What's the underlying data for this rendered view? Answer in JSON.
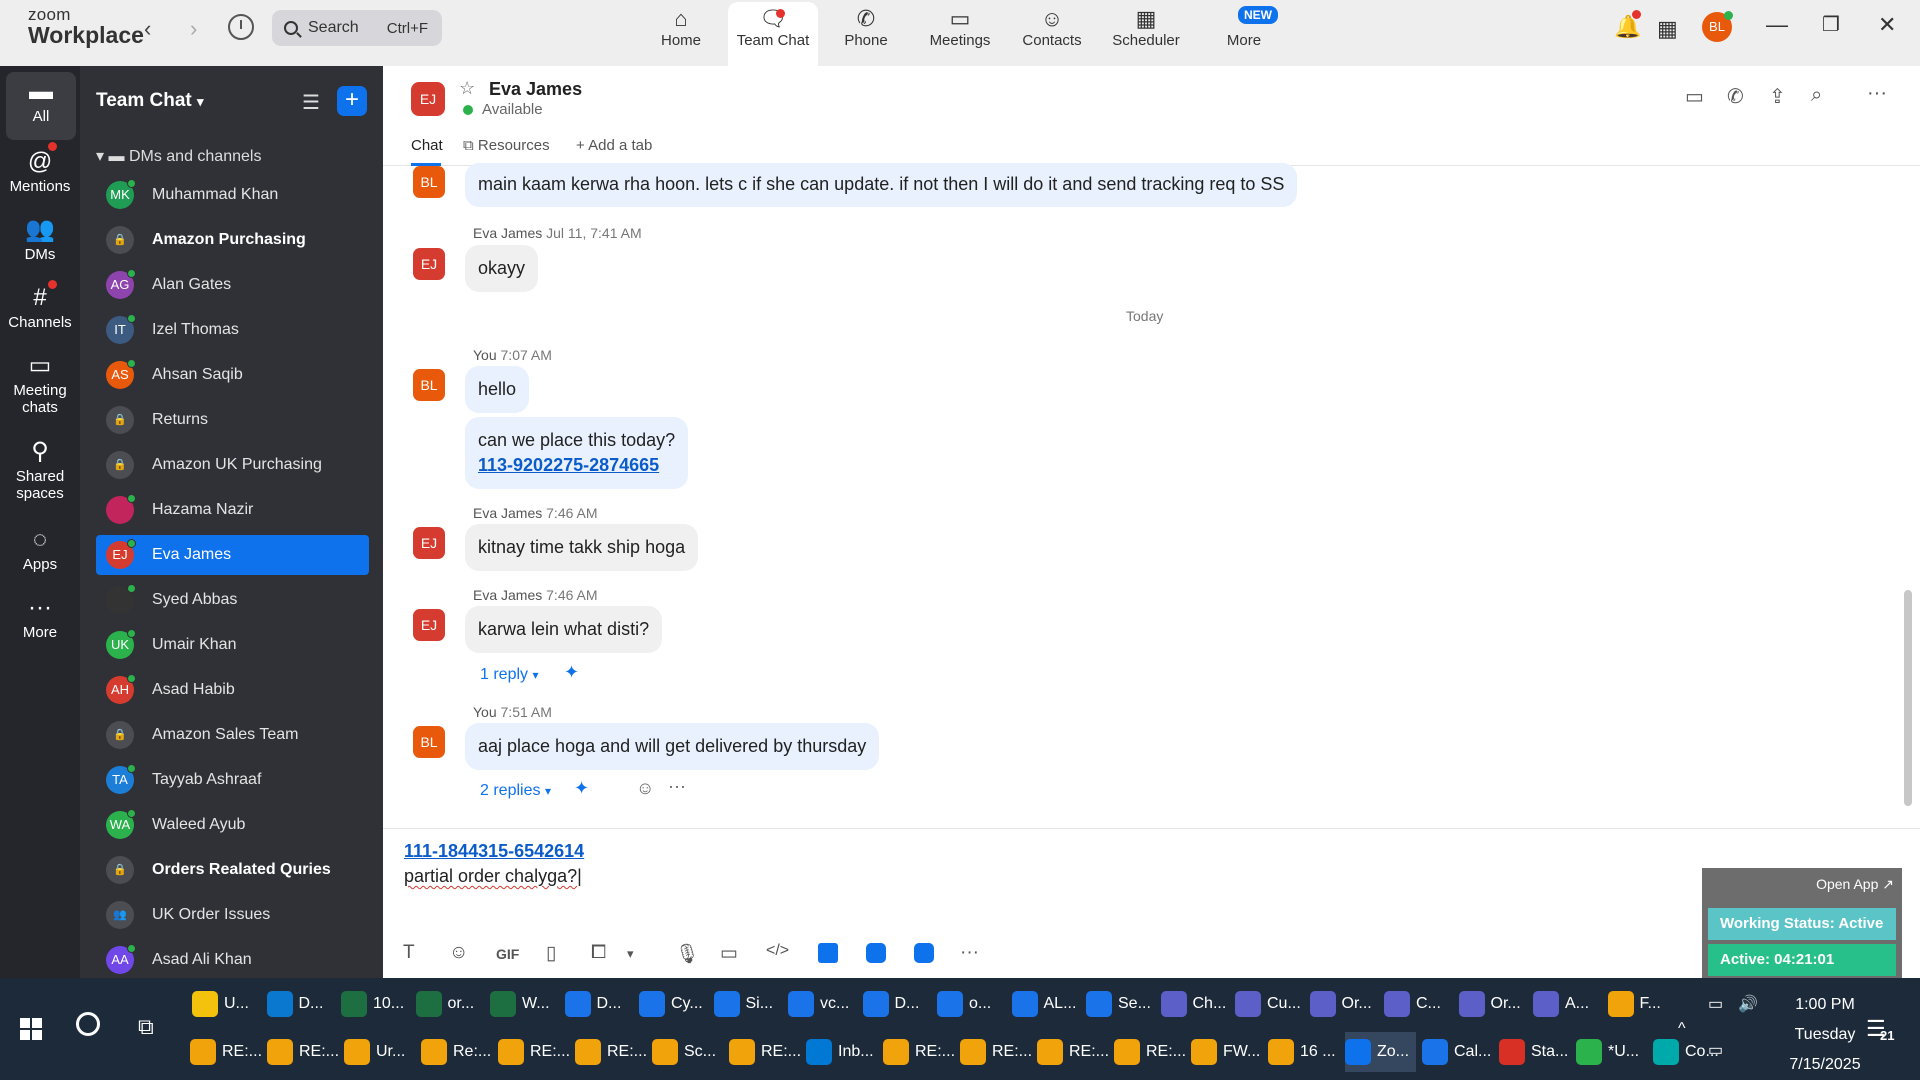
{
  "app": {
    "logo_line1": "zoom",
    "logo_line2": "Workplace"
  },
  "topbar": {
    "search_label": "Search",
    "search_shortcut": "Ctrl+F",
    "nav": [
      {
        "label": "Home",
        "icon": "home-icon"
      },
      {
        "label": "Team Chat",
        "icon": "team-chat-icon"
      },
      {
        "label": "Phone",
        "icon": "phone-icon"
      },
      {
        "label": "Meetings",
        "icon": "video-camera-icon"
      },
      {
        "label": "Contacts",
        "icon": "contacts-icon"
      },
      {
        "label": "Scheduler",
        "icon": "calendar-icon"
      },
      {
        "label": "More",
        "icon": "more-icon"
      }
    ],
    "new_badge": "NEW",
    "user_initials": "BL"
  },
  "rail": [
    {
      "label": "All",
      "icon": "chat-bubble-icon"
    },
    {
      "label": "Mentions",
      "icon": "at-icon"
    },
    {
      "label": "DMs",
      "icon": "people-icon"
    },
    {
      "label": "Channels",
      "icon": "hash-icon"
    },
    {
      "label": "Meeting\nchats",
      "label1": "Meeting",
      "label2": "chats",
      "icon": "calendar-icon"
    },
    {
      "label1": "Shared",
      "label2": "spaces",
      "icon": "shared-spaces-icon"
    },
    {
      "label": "Apps",
      "icon": "apps-icon"
    },
    {
      "label": "More",
      "icon": "ellipsis-icon"
    }
  ],
  "sidebar": {
    "title": "Team Chat",
    "section": "DMs and channels",
    "items": [
      {
        "name": "Muhammad Khan",
        "initials": "MK",
        "color": "#1f9d55"
      },
      {
        "name": "Amazon Purchasing",
        "initials": "",
        "lock": true,
        "bold": true
      },
      {
        "name": "Alan Gates",
        "initials": "AG",
        "color": "#8e44ad"
      },
      {
        "name": "Izel Thomas",
        "initials": "IT",
        "color": "#3d5a80"
      },
      {
        "name": "Ahsan Saqib",
        "initials": "AS",
        "color": "#e8590c"
      },
      {
        "name": "Returns",
        "initials": "",
        "lock": true
      },
      {
        "name": "Amazon UK Purchasing",
        "initials": "",
        "lock": true
      },
      {
        "name": "Hazama Nazir",
        "initials": "",
        "color": "#c2255c"
      },
      {
        "name": "Eva James",
        "initials": "EJ",
        "color": "#d53b2f"
      },
      {
        "name": "Syed Abbas",
        "initials": "",
        "color": "#333"
      },
      {
        "name": "Umair Khan",
        "initials": "UK",
        "color": "#2bb24c"
      },
      {
        "name": "Asad Habib",
        "initials": "AH",
        "color": "#d53b2f"
      },
      {
        "name": "Amazon Sales Team",
        "initials": "",
        "lock": true
      },
      {
        "name": "Tayyab Ashraaf",
        "initials": "TA",
        "color": "#1c7ed6"
      },
      {
        "name": "Waleed Ayub",
        "initials": "WA",
        "color": "#2bb24c"
      },
      {
        "name": "Orders Realated Quries",
        "initials": "",
        "lock": true,
        "bold": true
      },
      {
        "name": "UK Order Issues",
        "initials": "",
        "group": true
      },
      {
        "name": "Asad Ali Khan",
        "initials": "AA",
        "color": "#7048e8"
      }
    ]
  },
  "conversation": {
    "initials": "EJ",
    "name": "Eva James",
    "status": "Available",
    "tabs": [
      "Chat",
      "Resources",
      "Add a tab"
    ]
  },
  "messages": [
    {
      "avatar": "BL",
      "text": "main kaam kerwa rha hoon. lets c if she can update. if not then I will do it and send tracking req to SS"
    },
    {
      "sender": "Eva James",
      "time": "Jul 11, 7:41 AM",
      "avatar": "EJ",
      "text": "okayy"
    },
    {
      "divider": "Today"
    },
    {
      "sender": "You",
      "time": "7:07 AM",
      "avatar": "BL",
      "text": "hello"
    },
    {
      "text": "can we place this today?",
      "link": "113-9202275-2874665"
    },
    {
      "sender": "Eva James",
      "time": "7:46 AM",
      "avatar": "EJ",
      "text": "kitnay time takk ship hoga"
    },
    {
      "sender": "Eva James",
      "time": "7:46 AM",
      "avatar": "EJ",
      "text": "karwa lein what disti?",
      "replies": "1 reply"
    },
    {
      "sender": "You",
      "time": "7:51 AM",
      "avatar": "BL",
      "text": "aaj place hoga and will get delivered by thursday",
      "replies": "2 replies"
    }
  ],
  "composer": {
    "link": "111-1844315-6542614",
    "text": "partial order chalyga?"
  },
  "widget": {
    "open_app": "Open App",
    "working_status": "Working Status: Active",
    "active_timer": "Active: 04:21:01"
  },
  "taskbar": {
    "row1": [
      {
        "label": "U...",
        "color": "#f4c20d"
      },
      {
        "label": "D...",
        "color": "#0b78d0"
      },
      {
        "label": "10...",
        "color": "#1d6f42"
      },
      {
        "label": "or...",
        "color": "#1d6f42"
      },
      {
        "label": "W...",
        "color": "#1d6f42"
      },
      {
        "label": "D...",
        "color": "#1a73e8"
      },
      {
        "label": "Cy...",
        "color": "#1a73e8"
      },
      {
        "label": "Si...",
        "color": "#1a73e8"
      },
      {
        "label": "vc...",
        "color": "#1a73e8"
      },
      {
        "label": "D...",
        "color": "#1a73e8"
      },
      {
        "label": "o...",
        "color": "#1a73e8"
      },
      {
        "label": "AL...",
        "color": "#1a73e8"
      },
      {
        "label": "Se...",
        "color": "#1a73e8"
      },
      {
        "label": "Ch...",
        "color": "#5b5fc7"
      },
      {
        "label": "Cu...",
        "color": "#5b5fc7"
      },
      {
        "label": "Or...",
        "color": "#5b5fc7"
      },
      {
        "label": "C...",
        "color": "#5b5fc7"
      },
      {
        "label": "Or...",
        "color": "#5b5fc7"
      },
      {
        "label": "A...",
        "color": "#5b5fc7"
      },
      {
        "label": "F...",
        "color": "#f0a30a"
      }
    ],
    "row2": [
      {
        "label": "RE:...",
        "color": "#f0a30a"
      },
      {
        "label": "RE:...",
        "color": "#f0a30a"
      },
      {
        "label": "Ur...",
        "color": "#f0a30a"
      },
      {
        "label": "Re:...",
        "color": "#f0a30a"
      },
      {
        "label": "RE:...",
        "color": "#f0a30a"
      },
      {
        "label": "RE:...",
        "color": "#f0a30a"
      },
      {
        "label": "Sc...",
        "color": "#f0a30a"
      },
      {
        "label": "RE:...",
        "color": "#f0a30a"
      },
      {
        "label": "Inb...",
        "color": "#0078d4"
      },
      {
        "label": "RE:...",
        "color": "#f0a30a"
      },
      {
        "label": "RE:...",
        "color": "#f0a30a"
      },
      {
        "label": "RE:...",
        "color": "#f0a30a"
      },
      {
        "label": "RE:...",
        "color": "#f0a30a"
      },
      {
        "label": "FW...",
        "color": "#f0a30a"
      },
      {
        "label": "16 ...",
        "color": "#f0a30a"
      },
      {
        "label": "Zo...",
        "color": "#0e72ed"
      },
      {
        "label": "Cal...",
        "color": "#1a73e8"
      },
      {
        "label": "Sta...",
        "color": "#d93025"
      },
      {
        "label": "*U...",
        "color": "#2bb24c"
      },
      {
        "label": "Co...",
        "color": "#0aa"
      }
    ],
    "time": "1:00 PM",
    "day": "Tuesday",
    "date": "7/15/2025",
    "notification_count": "21"
  }
}
